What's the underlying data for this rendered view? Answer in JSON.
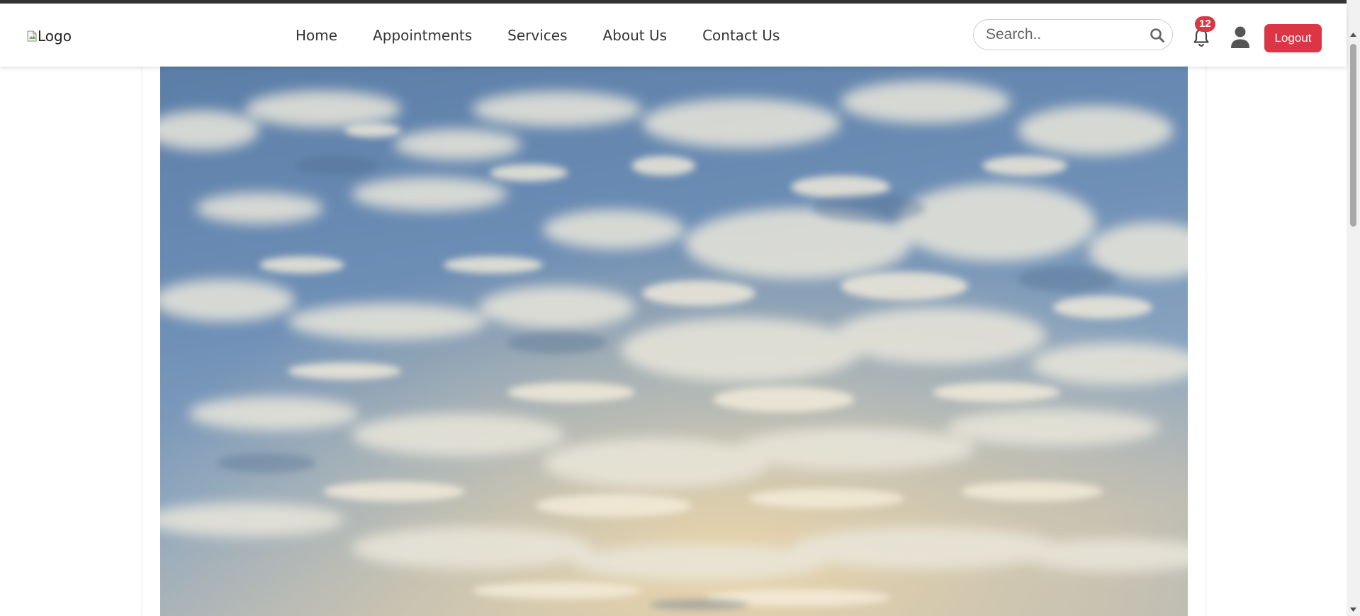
{
  "header": {
    "logo_alt": "Logo",
    "nav": [
      {
        "label": "Home"
      },
      {
        "label": "Appointments"
      },
      {
        "label": "Services"
      },
      {
        "label": "About Us"
      },
      {
        "label": "Contact Us"
      }
    ],
    "search": {
      "placeholder": "Search..",
      "value": ""
    },
    "notifications": {
      "count": "12"
    },
    "logout_label": "Logout"
  },
  "hero": {
    "image": "sky-with-clouds"
  },
  "colors": {
    "accent": "#dc3545",
    "nav_text": "#333333"
  }
}
